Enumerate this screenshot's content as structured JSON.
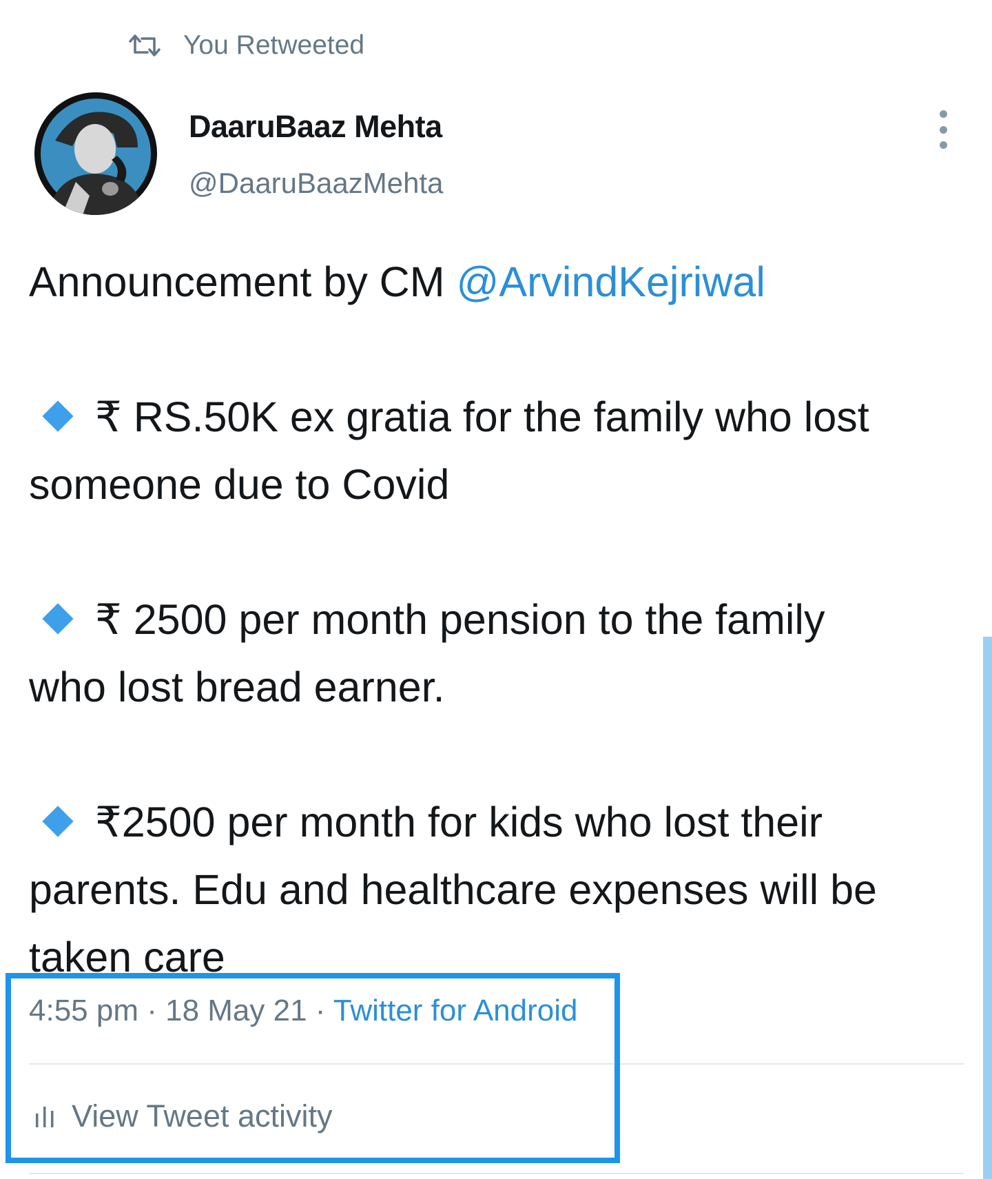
{
  "retweet": {
    "icon": "retweet-icon",
    "label": "You Retweeted"
  },
  "author": {
    "name": "DaaruBaaz Mehta",
    "handle": "@DaaruBaazMehta",
    "avatar_icon": "avatar-detective"
  },
  "tweet": {
    "line1_prefix": "Announcement by CM ",
    "mention": "@ArvindKejriwal",
    "bullet1_line1": "₹ RS.50K ex gratia for the family who lost",
    "bullet1_line2": "someone due to Covid",
    "bullet2_line1": "₹ 2500 per month pension to the family",
    "bullet2_line2": "who lost  bread earner.",
    "bullet3_line1": "₹2500 per month for kids who lost their",
    "bullet3_line2": "parents. Edu and healthcare expenses will be",
    "bullet3_line3": "taken care"
  },
  "meta": {
    "time": "4:55 pm",
    "sep1": " · ",
    "date": "18 May 21",
    "sep2": " · ",
    "source": "Twitter for Android"
  },
  "activity": {
    "icon": "bar-chart-icon",
    "label": "View Tweet activity"
  },
  "colors": {
    "link": "#2b8fd6",
    "muted": "#657786",
    "highlight": "#1d95e8",
    "bullet": "#3ea0ea"
  }
}
